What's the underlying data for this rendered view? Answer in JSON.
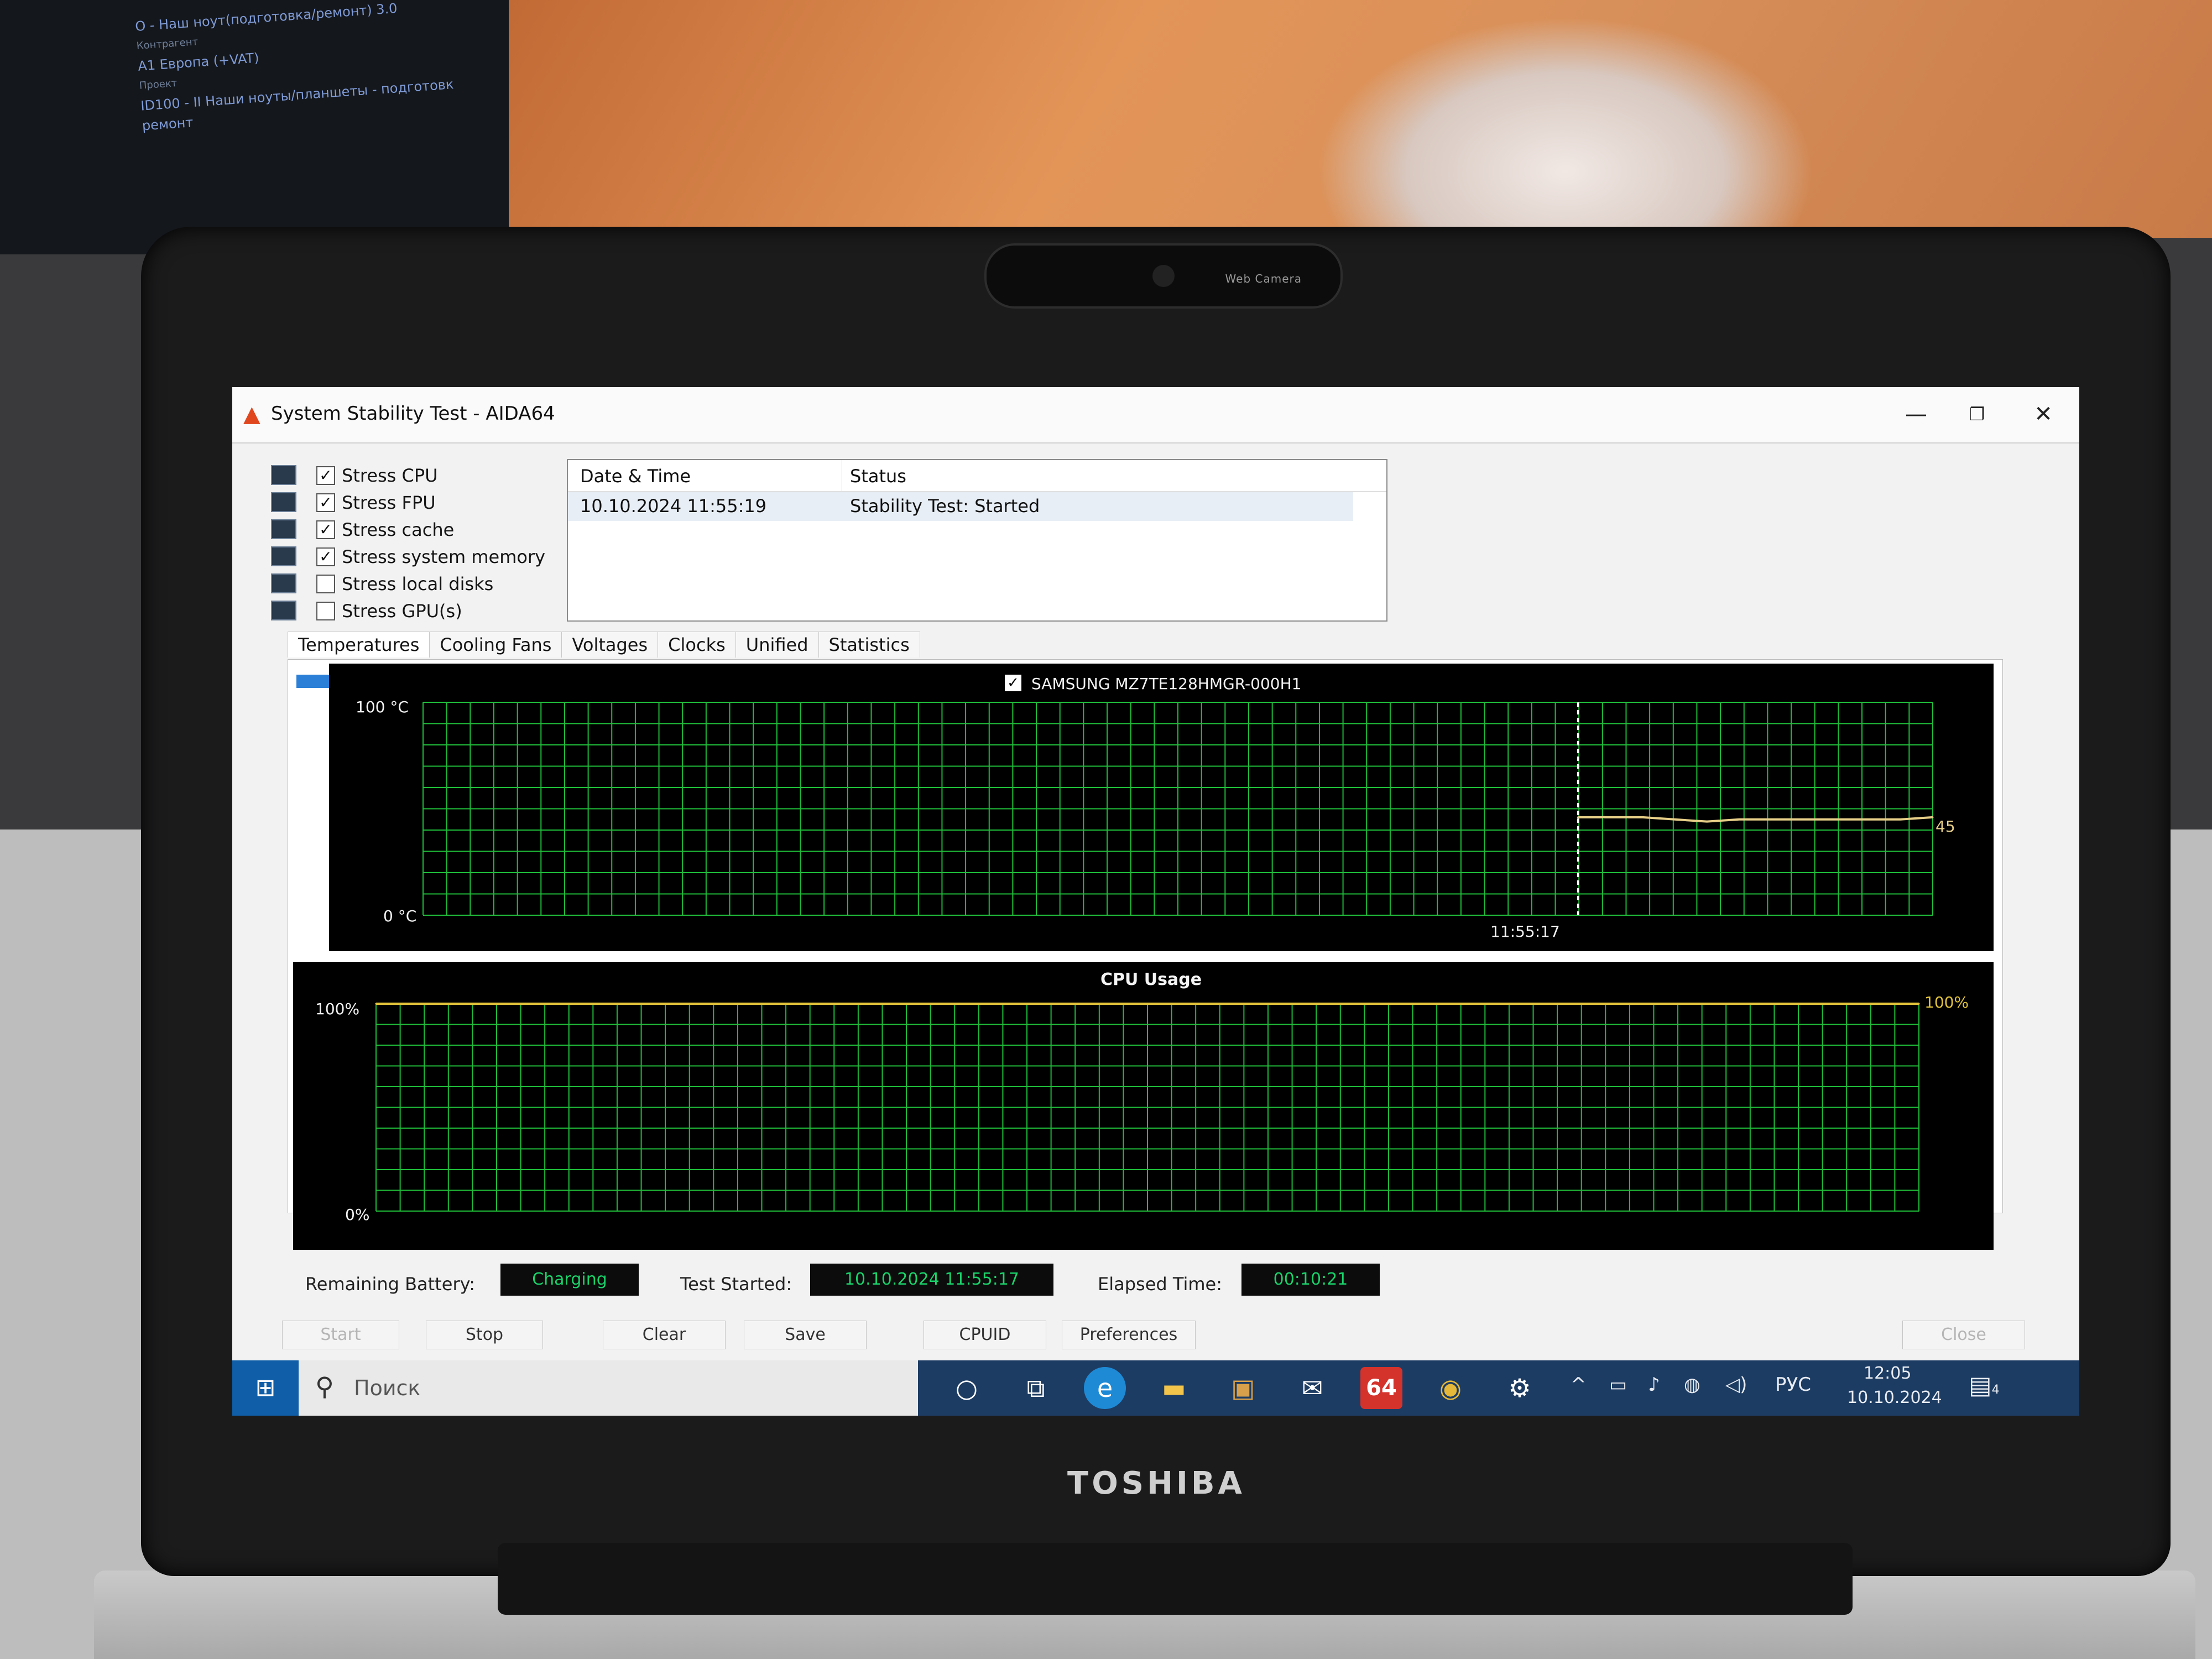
{
  "window": {
    "title": "System Stability Test - AIDA64",
    "minimize": "—",
    "restore": "❐",
    "close": "✕"
  },
  "stress_options": [
    {
      "label": "Stress CPU",
      "checked": true,
      "icon": "cpu-icon"
    },
    {
      "label": "Stress FPU",
      "checked": true,
      "icon": "fpu-icon"
    },
    {
      "label": "Stress cache",
      "checked": true,
      "icon": "cache-icon"
    },
    {
      "label": "Stress system memory",
      "checked": true,
      "icon": "memory-icon"
    },
    {
      "label": "Stress local disks",
      "checked": false,
      "icon": "disk-icon"
    },
    {
      "label": "Stress GPU(s)",
      "checked": false,
      "icon": "gpu-icon"
    }
  ],
  "log": {
    "columns": [
      "Date & Time",
      "Status"
    ],
    "rows": [
      {
        "datetime": "10.10.2024 11:55:19",
        "status": "Stability Test: Started"
      }
    ]
  },
  "tabs": [
    "Temperatures",
    "Cooling Fans",
    "Voltages",
    "Clocks",
    "Unified",
    "Statistics"
  ],
  "active_tab": "Temperatures",
  "temperature_chart": {
    "legend": "SAMSUNG MZ7TE128HMGR-000H1",
    "y_max_label": "100 °C",
    "y_min_label": "0 °C",
    "time_label": "11:55:17",
    "current_value_label": "45"
  },
  "cpu_chart": {
    "title": "CPU Usage",
    "y_max_label": "100%",
    "y_min_label": "0%",
    "current_value_label": "100%"
  },
  "chart_data": [
    {
      "type": "line",
      "title": "",
      "series": [
        {
          "name": "SAMSUNG MZ7TE128HMGR-000H1",
          "values": [
            46,
            46,
            46,
            45,
            44,
            45,
            45,
            45,
            45,
            45,
            45,
            46
          ]
        }
      ],
      "ylim": [
        0,
        100
      ],
      "ylabel": "°C",
      "x": [
        "11:55:17"
      ],
      "grid": true,
      "colors": {
        "line": "#e7cf88",
        "grid": "#1fbf3a",
        "background": "#000000"
      }
    },
    {
      "type": "line",
      "title": "CPU Usage",
      "series": [
        {
          "name": "CPU Usage",
          "values": [
            100,
            100,
            100,
            100,
            100,
            100,
            100,
            100,
            100,
            100
          ]
        }
      ],
      "ylim": [
        0,
        100
      ],
      "ylabel": "%",
      "grid": true,
      "colors": {
        "line": "#e2c33a",
        "grid": "#1fbf3a",
        "background": "#000000"
      }
    }
  ],
  "status": {
    "battery_label": "Remaining Battery:",
    "battery_value": "Charging",
    "test_started_label": "Test Started:",
    "test_started_value": "10.10.2024 11:55:17",
    "elapsed_label": "Elapsed Time:",
    "elapsed_value": "00:10:21"
  },
  "buttons": {
    "start": "Start",
    "stop": "Stop",
    "clear": "Clear",
    "save": "Save",
    "cpuid": "CPUID",
    "preferences": "Preferences",
    "close": "Close"
  },
  "taskbar": {
    "search_placeholder": "Поиск",
    "aida_badge": "64",
    "language": "РУС",
    "time": "12:05",
    "date": "10.10.2024",
    "notification_count": "4"
  },
  "background": {
    "monitor_lines": [
      "О - Наш ноут(подготовка/ремонт) 3.0",
      "Контрагент",
      "А1 Европа (+VAT)",
      "Проект",
      "ID100 - II Наши ноуты/планшеты - подготовк",
      "ремонт"
    ],
    "webcam_label": "Web Camera",
    "brand": "TOSHIBA"
  },
  "colors": {
    "grid_green": "#1fbf3a",
    "status_text_green": "#19d36a",
    "taskbar": "#1d3c63",
    "start_blue": "#0f5ea7"
  }
}
